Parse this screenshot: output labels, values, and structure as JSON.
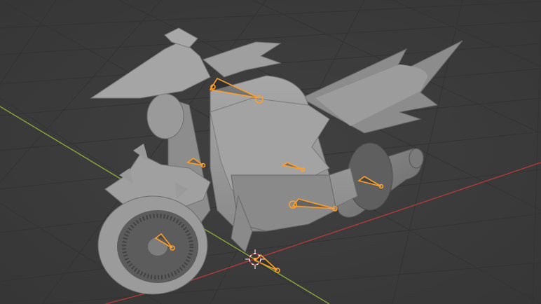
{
  "viewport": {
    "mode": "Solid",
    "background_color": "#3b3b3b",
    "grid_color": "#2f2f2f",
    "x_axis_color": "#b83a3a",
    "y_axis_color": "#8fb23a",
    "mesh_color": "#9a9a9a",
    "mesh_dark_color": "#6e6e6e",
    "bone_color": "#ff9f2a",
    "scene_object": "motorcycle-mesh",
    "rig": "armature",
    "bone_count": 8,
    "origin_icon": "3d-cursor-icon"
  }
}
